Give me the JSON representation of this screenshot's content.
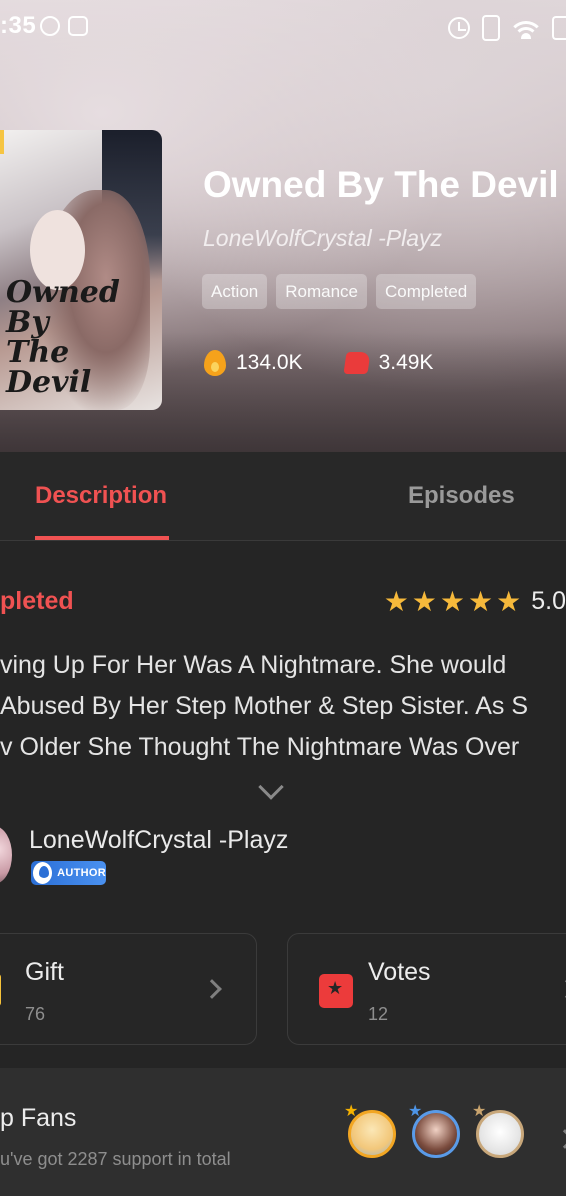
{
  "status_bar": {
    "time": ":35"
  },
  "book": {
    "cover_art_text": "Owned\nBy\nThe\nDevil",
    "title": "Owned By The Devil",
    "author": "LoneWolfCrystal -Playz",
    "tags": [
      "Action",
      "Romance",
      "Completed"
    ],
    "views": "134.0K",
    "likes": "3.49K"
  },
  "tabs": {
    "description": "Description",
    "episodes": "Episodes"
  },
  "details": {
    "status": "pleted",
    "rating": "5.0",
    "stars": 5,
    "description_lines": [
      "ving Up For Her Was A Nightmare. She would",
      "Abused By Her Step Mother & Step Sister. As S",
      "v Older She Thought The Nightmare Was Over"
    ]
  },
  "author_section": {
    "name": "LoneWolfCrystal -Playz",
    "badge": "AUTHOR"
  },
  "cards": {
    "gift": {
      "title": "Gift",
      "count": "76"
    },
    "votes": {
      "title": "Votes",
      "count": "12"
    }
  },
  "top_fans": {
    "title": "p Fans",
    "subtitle": "u've got 2287 support in total"
  },
  "colors": {
    "accent": "#f05252",
    "star": "#f6b93b",
    "background": "#252525"
  }
}
